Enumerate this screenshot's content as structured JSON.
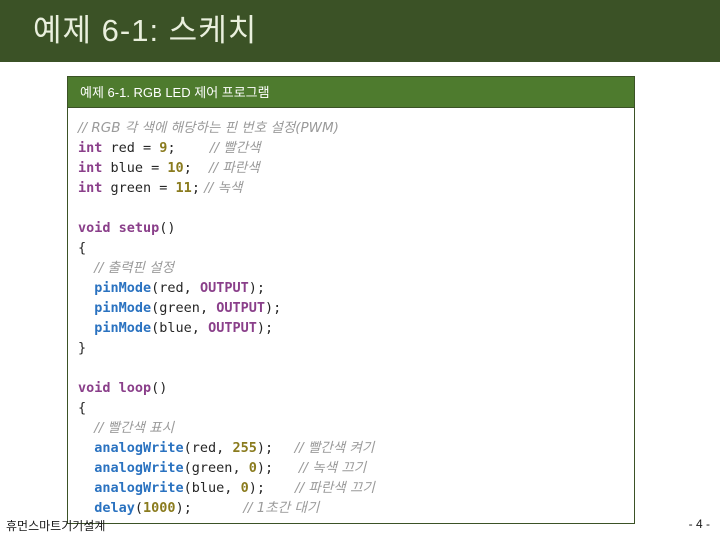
{
  "slide": {
    "title": "예제 6-1: 스케치",
    "title_bar_color": "#3B5226",
    "title_text_color": "#E9EFDD"
  },
  "code_card": {
    "header": "예제 6-1. RGB LED 제어 프로그램",
    "header_color": "#4E7B2E",
    "border_color": "#3B5226",
    "background": "#FFFFFF",
    "syntax_colors": {
      "keyword": "#8A3F8A",
      "function": "#2A72C0",
      "number": "#8A7B1E",
      "constant": "#8A3F8A",
      "comment": "#9A9A9A",
      "plain": "#262626"
    },
    "lines": {
      "l01_comment": "// RGB 각 색에 해당하는 핀 번호 설정(PWM)",
      "l02_kw": "int",
      "l02_name": " red = ",
      "l02_num": "9",
      "l02_semi": ";",
      "l02_comment": "// 빨간색",
      "l03_kw": "int",
      "l03_name": " blue = ",
      "l03_num": "10",
      "l03_semi": ";",
      "l03_comment": "// 파란색",
      "l04_kw": "int",
      "l04_name": " green = ",
      "l04_num": "11",
      "l04_semi": ";",
      "l04_comment": "// 녹색",
      "l06_kw": "void",
      "l06_fn": " setup",
      "l06_paren": "()",
      "l07_brace": "{",
      "l08_comment": "// 출력핀 설정",
      "l09_fn": "pinMode",
      "l09_a": "(red, ",
      "l09_const": "OUTPUT",
      "l09_b": ");",
      "l10_fn": "pinMode",
      "l10_a": "(green, ",
      "l10_const": "OUTPUT",
      "l10_b": ");",
      "l11_fn": "pinMode",
      "l11_a": "(blue, ",
      "l11_const": "OUTPUT",
      "l11_b": ");",
      "l12_brace": "}",
      "l14_kw": "void",
      "l14_fn": " loop",
      "l14_paren": "()",
      "l15_brace": "{",
      "l16_comment": "// 빨간색 표시",
      "l17_fn": "analogWrite",
      "l17_a": "(red, ",
      "l17_num": "255",
      "l17_b": ");",
      "l17_comment": "// 빨간색 켜기",
      "l18_fn": "analogWrite",
      "l18_a": "(green, ",
      "l18_num": "0",
      "l18_b": ");",
      "l18_comment": "// 녹색 끄기",
      "l19_fn": "analogWrite",
      "l19_a": "(blue, ",
      "l19_num": "0",
      "l19_b": ");",
      "l19_comment": "// 파란색 끄기",
      "l20_fn": "delay",
      "l20_a": "(",
      "l20_num": "1000",
      "l20_b": ");",
      "l20_comment": "// 1초간 대기",
      "l21_ellipsis": "…"
    }
  },
  "footer": {
    "organization": "휴먼스마트기기설계",
    "page_number": "- 4 -"
  }
}
